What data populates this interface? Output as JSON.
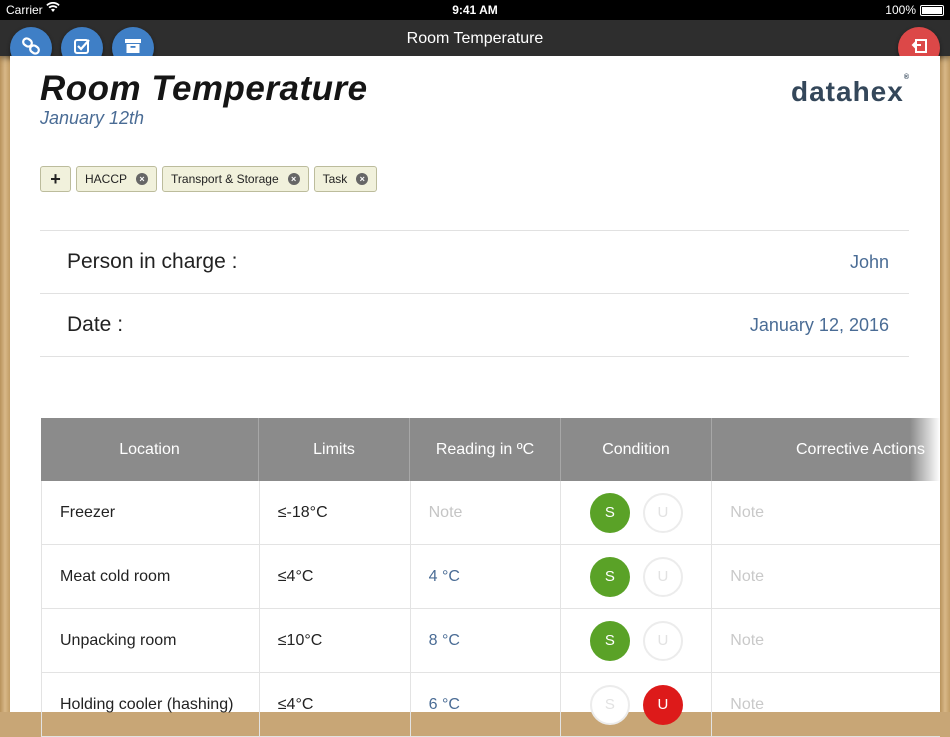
{
  "status_bar": {
    "carrier": "Carrier",
    "time": "9:41 AM",
    "battery": "100%"
  },
  "nav": {
    "title": "Room Temperature"
  },
  "toolbar_icons": [
    "link-icon",
    "checkbox-icon",
    "archive-icon",
    "return-icon"
  ],
  "header": {
    "title": "Room Temperature",
    "subtitle": "January 12th",
    "logo": "datahex",
    "logo_mark": "®"
  },
  "tags": {
    "add_label": "+",
    "items": [
      "HACCP",
      "Transport & Storage",
      "Task"
    ],
    "remove_glyph": "×"
  },
  "form": {
    "person_label": "Person in charge :",
    "person_value": "John",
    "date_label": "Date :",
    "date_value": "January 12, 2016"
  },
  "table": {
    "headers": [
      "Location",
      "Limits",
      "Reading in ºC",
      "Condition",
      "Corrective Actions"
    ],
    "rows": [
      {
        "location": "Freezer",
        "limit": "≤-18°C",
        "reading": "Note",
        "reading_is_placeholder": true,
        "s": "S",
        "u": "U",
        "condition": "S",
        "action": "Note"
      },
      {
        "location": "Meat cold room",
        "limit": "≤4°C",
        "reading": "4 °C",
        "reading_is_placeholder": false,
        "s": "S",
        "u": "U",
        "condition": "S",
        "action": "Note"
      },
      {
        "location": "Unpacking room",
        "limit": "≤10°C",
        "reading": "8 °C",
        "reading_is_placeholder": false,
        "s": "S",
        "u": "U",
        "condition": "S",
        "action": "Note"
      },
      {
        "location": "Holding cooler (hashing)",
        "limit": "≤4°C",
        "reading": "6 °C",
        "reading_is_placeholder": false,
        "s": "S",
        "u": "U",
        "condition": "U",
        "action": "Note"
      }
    ]
  },
  "colors": {
    "accent_blue": "#3f7fc6",
    "danger_red": "#dc4848",
    "satisfactory_green": "#5aa227",
    "unsatisfactory_red": "#dd1a1a",
    "value_text": "#4a6c95"
  }
}
